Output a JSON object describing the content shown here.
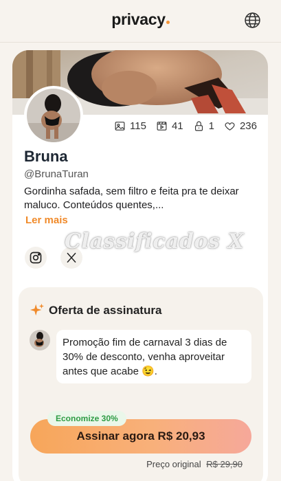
{
  "header": {
    "logo_text": "privacy",
    "globe_icon": "globe-icon"
  },
  "profile": {
    "name": "Bruna",
    "handle": "@BrunaTuran",
    "bio": "Gordinha safada, sem filtro e feita pra te deixar maluco. Conteúdos quentes,...",
    "read_more": "Ler mais",
    "stats": {
      "photos": "115",
      "videos": "41",
      "locked": "1",
      "likes": "236"
    },
    "socials": [
      "instagram-icon",
      "x-icon"
    ]
  },
  "watermark": "Classificados X",
  "offer": {
    "title": "Oferta de assinatura",
    "message": "Promoção fim de carnaval 3 dias de 30% de desconto, venha aproveitar antes que acabe 😉.",
    "savings_badge": "Economize 30%",
    "cta_label": "Assinar agora R$ 20,93",
    "original_label": "Preço original",
    "original_price": "R$ 29,90"
  },
  "colors": {
    "accent": "#f08a2a",
    "savings_green": "#2e9c45",
    "background": "#f7f3ee"
  }
}
